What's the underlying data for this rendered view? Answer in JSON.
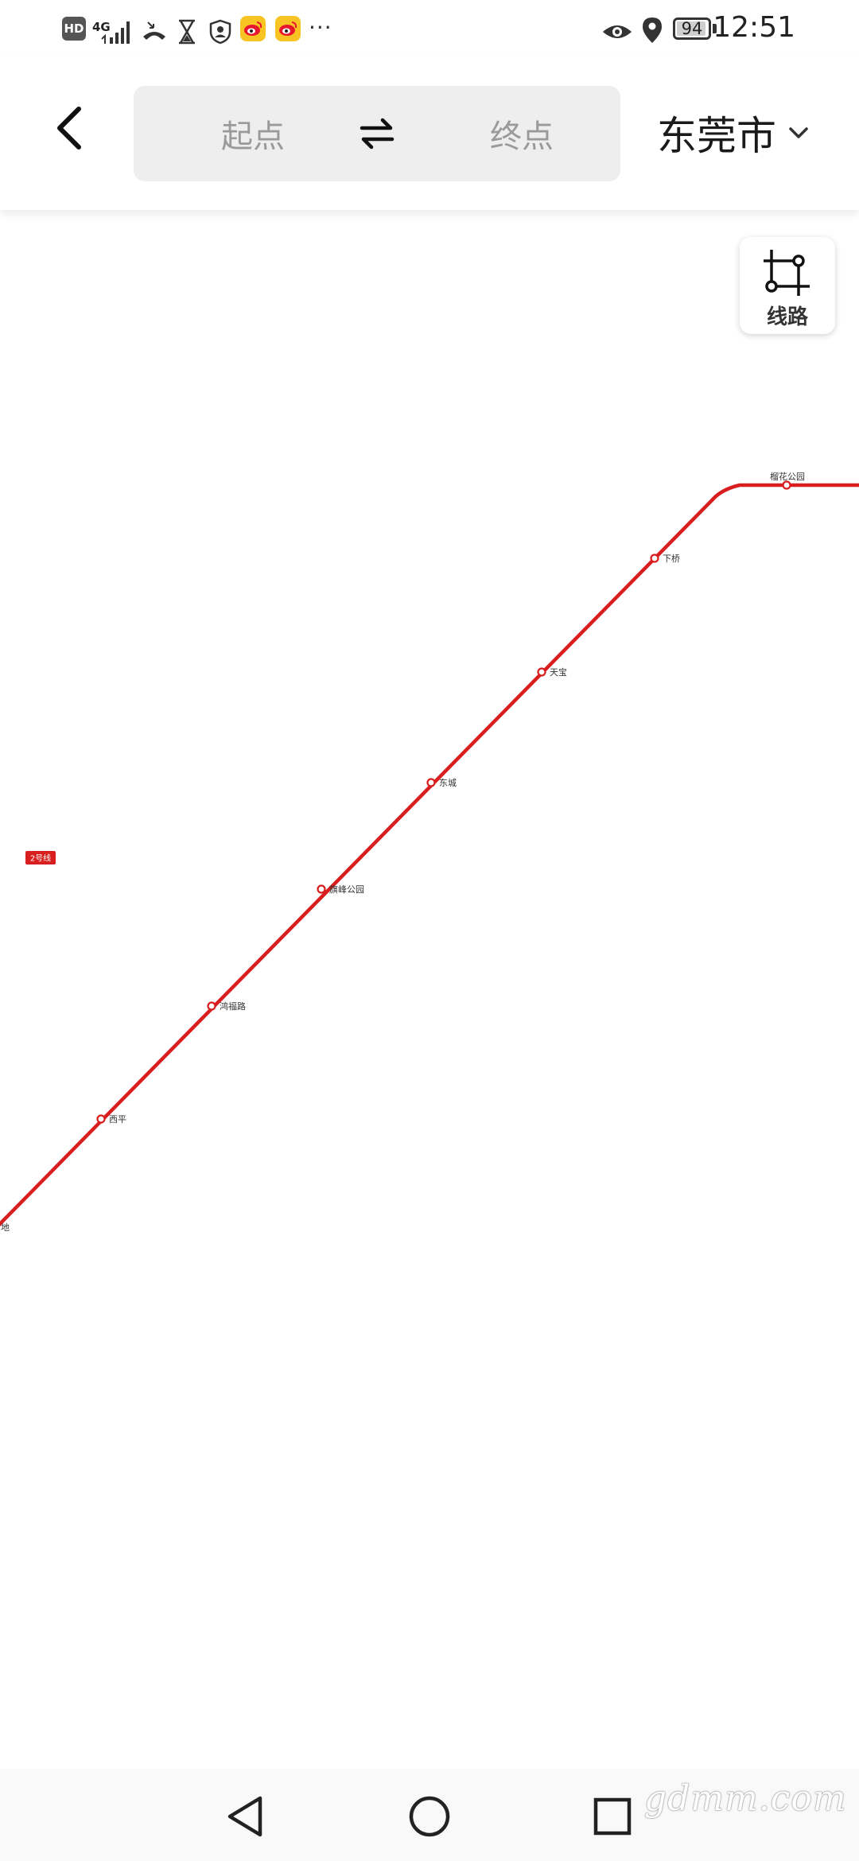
{
  "status_bar": {
    "hd_label": "HD",
    "network_label": "4G",
    "battery_level": "94",
    "battery_fraction": 0.94,
    "time": "12:51",
    "more_label": "···"
  },
  "header": {
    "start_placeholder": "起点",
    "end_placeholder": "终点",
    "city": "东莞市"
  },
  "map": {
    "lines_button_label": "线路",
    "line_color": "#d81e1e",
    "line_badge": "2号线",
    "stations": [
      "榴花公园",
      "下桥",
      "天宝",
      "东城",
      "旗峰公园",
      "鸿福路",
      "西平",
      "蛤地"
    ]
  },
  "watermark": "gdmm.com",
  "colors": {
    "accent_red": "#d81e1e",
    "route_box_bg": "#eeeeee",
    "placeholder_text": "#9a9a9a"
  }
}
